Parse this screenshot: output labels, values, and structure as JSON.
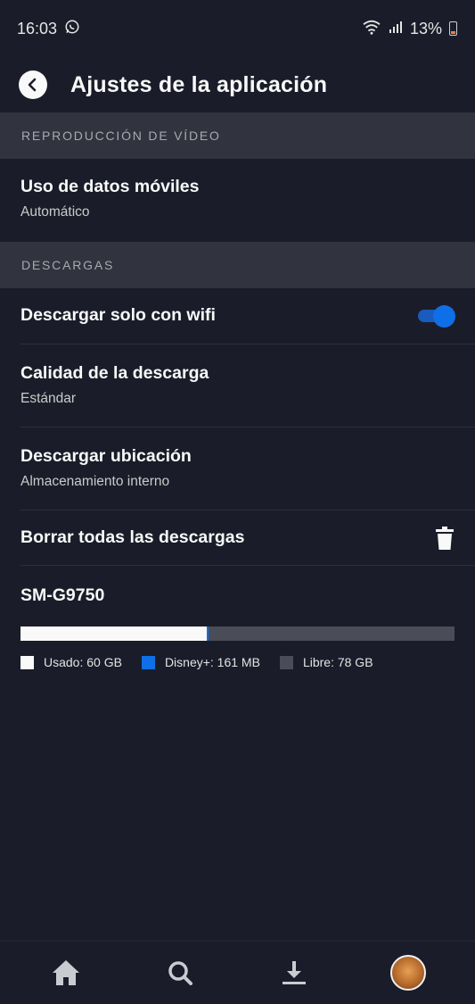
{
  "status_bar": {
    "time": "16:03",
    "battery": "13%"
  },
  "header": {
    "title": "Ajustes de la aplicación"
  },
  "sections": {
    "video": {
      "header": "REPRODUCCIÓN DE VÍDEO"
    },
    "downloads": {
      "header": "DESCARGAS"
    }
  },
  "settings": {
    "mobile_data": {
      "title": "Uso de datos móviles",
      "value": "Automático"
    },
    "wifi_only": {
      "title": "Descargar solo con wifi",
      "enabled": true
    },
    "quality": {
      "title": "Calidad de la descarga",
      "value": "Estándar"
    },
    "location": {
      "title": "Descargar ubicación",
      "value": "Almacenamiento interno"
    },
    "delete_all": {
      "title": "Borrar todas las descargas"
    }
  },
  "storage": {
    "device": "SM-G9750",
    "used_fraction": 0.43,
    "disney_fraction": 0.003,
    "legend": {
      "used": "Usado: 60 GB",
      "disney": "Disney+: 161 MB",
      "free": "Libre: 78 GB"
    },
    "colors": {
      "used": "#f9f9f9",
      "disney": "#0f6fe8",
      "free": "#4a4d57"
    }
  },
  "bottom_nav": {
    "items": [
      "home-icon",
      "search-icon",
      "download-icon",
      "profile-avatar"
    ]
  },
  "colors": {
    "background": "#1a1d29",
    "section": "#31343e",
    "accent": "#0f6fe8"
  }
}
